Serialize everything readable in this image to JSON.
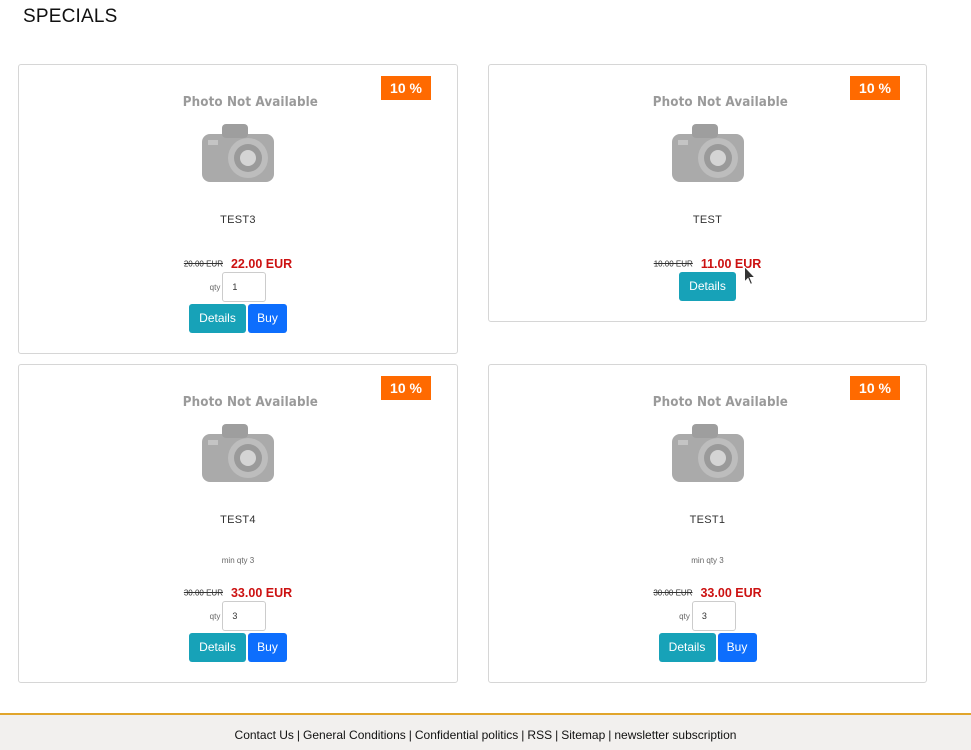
{
  "page": {
    "title": "SPECIALS"
  },
  "products": [
    {
      "badge": "10 %",
      "photo_text": "Photo Not Available",
      "name": "TEST3",
      "min_qty": "",
      "old_price": "20.00 EUR",
      "new_price": "22.00 EUR",
      "qty_label": "qty",
      "qty_value": "1",
      "details_label": "Details",
      "buy_label": "Buy"
    },
    {
      "badge": "10 %",
      "photo_text": "Photo Not Available",
      "name": "TEST",
      "min_qty": "",
      "old_price": "10.00 EUR",
      "new_price": "11.00 EUR",
      "details_label": "Details"
    },
    {
      "badge": "10 %",
      "photo_text": "Photo Not Available",
      "name": "TEST4",
      "min_qty": "min qty 3",
      "old_price": "30.00 EUR",
      "new_price": "33.00 EUR",
      "qty_label": "qty",
      "qty_value": "3",
      "details_label": "Details",
      "buy_label": "Buy"
    },
    {
      "badge": "10 %",
      "photo_text": "Photo Not Available",
      "name": "TEST1",
      "min_qty": "min qty 3",
      "old_price": "30.00 EUR",
      "new_price": "33.00 EUR",
      "qty_label": "qty",
      "qty_value": "3",
      "details_label": "Details",
      "buy_label": "Buy"
    }
  ],
  "footer": {
    "links": [
      "Contact Us",
      "General Conditions",
      "Confidential politics",
      "RSS",
      "Sitemap",
      "newsletter subscription"
    ],
    "separator": "|"
  },
  "colors": {
    "badge": "#ff6a00",
    "new_price": "#cc1111",
    "details_button": "#17a2b8",
    "buy_button": "#0d6efd",
    "footer_border": "#e1a52b"
  },
  "icons": {
    "photo_placeholder": "camera-icon",
    "pointer": "mouse-cursor-icon"
  }
}
